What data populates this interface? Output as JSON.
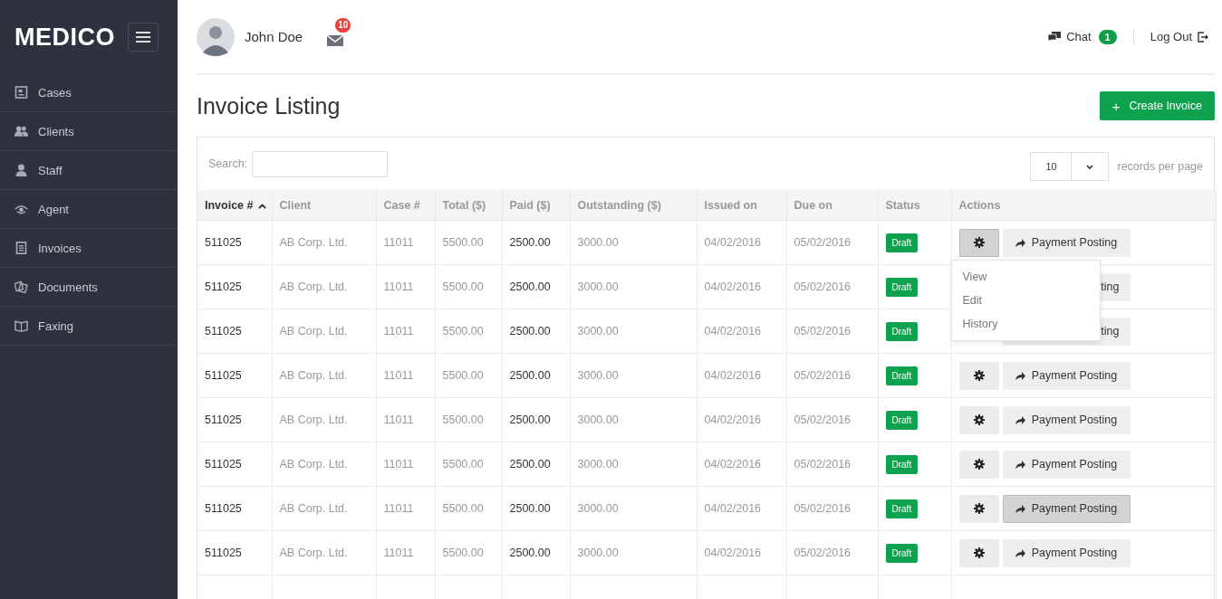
{
  "brand": {
    "name": "MEDICO"
  },
  "sidebar": {
    "items": [
      {
        "label": "Cases"
      },
      {
        "label": "Clients"
      },
      {
        "label": "Staff"
      },
      {
        "label": "Agent"
      },
      {
        "label": "Invoices"
      },
      {
        "label": "Documents"
      },
      {
        "label": "Faxing"
      }
    ]
  },
  "topbar": {
    "user": "John Doe",
    "mail_count": "10",
    "chat": "Chat",
    "chat_count": "1",
    "logout": "Log Out"
  },
  "page": {
    "title": "Invoice Listing",
    "create_button": "Create Invoice",
    "create_icon": "+"
  },
  "table": {
    "search_label": "Search:",
    "page_size": "10",
    "page_size_label": "records per page",
    "columns": [
      {
        "label": "Invoice #",
        "sorted": true
      },
      {
        "label": "Client",
        "sorted": false
      },
      {
        "label": "Case #",
        "sorted": false
      },
      {
        "label": "Total ($)",
        "sorted": false
      },
      {
        "label": "Paid ($)",
        "sorted": false
      },
      {
        "label": "Outstanding ($)",
        "sorted": false
      },
      {
        "label": "Issued on",
        "sorted": false
      },
      {
        "label": "Due on",
        "sorted": false
      },
      {
        "label": "Status",
        "sorted": false
      },
      {
        "label": "Actions",
        "sorted": false
      }
    ],
    "rows": [
      {
        "invoice": "511025",
        "client": "AB Corp. Ltd.",
        "case": "11011",
        "total": "5500.00",
        "paid": "2500.00",
        "outstanding": "3000.00",
        "issued": "04/02/2016",
        "due": "05/02/2016",
        "status": "Draft",
        "gear_pressed": true,
        "posting": "Payment Posting",
        "posting_hover": false,
        "posting_covered": false,
        "menu": [
          "View",
          "Edit",
          "History"
        ]
      },
      {
        "invoice": "511025",
        "client": "AB Corp. Ltd.",
        "case": "11011",
        "total": "5500.00",
        "paid": "2500.00",
        "outstanding": "3000.00",
        "issued": "04/02/2016",
        "due": "05/02/2016",
        "status": "Draft",
        "posting": "ting",
        "posting_hover": false,
        "posting_covered": true
      },
      {
        "invoice": "511025",
        "client": "AB Corp. Ltd.",
        "case": "11011",
        "total": "5500.00",
        "paid": "2500.00",
        "outstanding": "3000.00",
        "issued": "04/02/2016",
        "due": "05/02/2016",
        "status": "Draft",
        "posting": "ting",
        "posting_hover": false,
        "posting_covered": true
      },
      {
        "invoice": "511025",
        "client": "AB Corp. Ltd.",
        "case": "11011",
        "total": "5500.00",
        "paid": "2500.00",
        "outstanding": "3000.00",
        "issued": "04/02/2016",
        "due": "05/02/2016",
        "status": "Draft",
        "gear_pressed": false,
        "posting": "Payment Posting",
        "posting_hover": false,
        "posting_covered": false
      },
      {
        "invoice": "511025",
        "client": "AB Corp. Ltd.",
        "case": "11011",
        "total": "5500.00",
        "paid": "2500.00",
        "outstanding": "3000.00",
        "issued": "04/02/2016",
        "due": "05/02/2016",
        "status": "Draft",
        "gear_pressed": false,
        "posting": "Payment Posting",
        "posting_hover": false,
        "posting_covered": false
      },
      {
        "invoice": "511025",
        "client": "AB Corp. Ltd.",
        "case": "11011",
        "total": "5500.00",
        "paid": "2500.00",
        "outstanding": "3000.00",
        "issued": "04/02/2016",
        "due": "05/02/2016",
        "status": "Draft",
        "gear_pressed": false,
        "posting": "Payment Posting",
        "posting_hover": false,
        "posting_covered": false
      },
      {
        "invoice": "511025",
        "client": "AB Corp. Ltd.",
        "case": "11011",
        "total": "5500.00",
        "paid": "2500.00",
        "outstanding": "3000.00",
        "issued": "04/02/2016",
        "due": "05/02/2016",
        "status": "Draft",
        "gear_pressed": false,
        "posting": "Payment Posting",
        "posting_hover": true,
        "posting_covered": false
      },
      {
        "invoice": "511025",
        "client": "AB Corp. Ltd.",
        "case": "11011",
        "total": "5500.00",
        "paid": "2500.00",
        "outstanding": "3000.00",
        "issued": "04/02/2016",
        "due": "05/02/2016",
        "status": "Draft",
        "gear_pressed": false,
        "posting": "Payment Posting",
        "posting_hover": false,
        "posting_covered": false
      }
    ]
  }
}
